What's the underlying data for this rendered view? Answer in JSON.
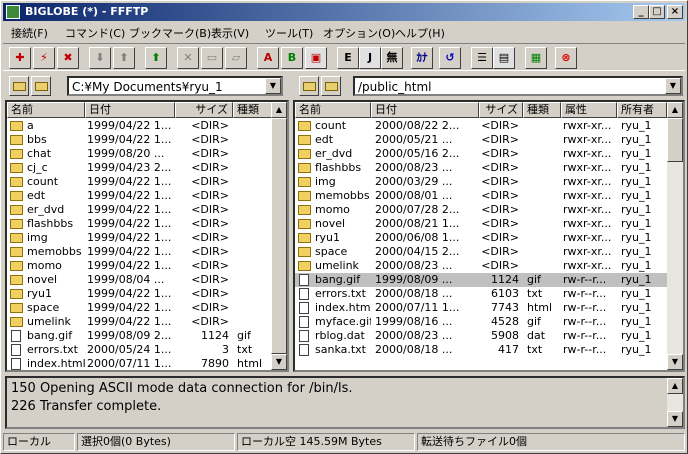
{
  "window": {
    "title": "BIGLOBE (*) - FFFTP",
    "minimize": "_",
    "maximize": "□",
    "close": "×"
  },
  "menu": [
    "接続(F)",
    "コマンド(C)",
    "ブックマーク(B)",
    "表示(V)",
    "ツール(T)",
    "オプション(O)",
    "ヘルプ(H)"
  ],
  "toolbar": {
    "buttons": [
      "connect",
      "quick-connect",
      "disconnect",
      "download",
      "upload",
      "mirror-upload",
      "delete",
      "rename",
      "mkdir",
      "ascii",
      "binary",
      "auto",
      "euc",
      "jis",
      "nokanji",
      "kana",
      "refresh",
      "list",
      "detail",
      "sync",
      "stop"
    ],
    "labels": {
      "ascii": "A",
      "binary": "B",
      "euc": "E",
      "jis": "J",
      "nokanji": "無",
      "kana": "ｶﾅ"
    }
  },
  "left": {
    "path": "C:¥My Documents¥ryu_1",
    "columns": [
      "名前",
      "日付",
      "サイズ",
      "種類"
    ],
    "rows": [
      {
        "name": "a",
        "date": "1999/04/22 1...",
        "size": "<DIR>",
        "type": "",
        "icon": "folder"
      },
      {
        "name": "bbs",
        "date": "1999/04/22 1...",
        "size": "<DIR>",
        "type": "",
        "icon": "folder"
      },
      {
        "name": "chat",
        "date": "1999/08/20 ...",
        "size": "<DIR>",
        "type": "",
        "icon": "folder"
      },
      {
        "name": "cj_c",
        "date": "1999/04/23 2...",
        "size": "<DIR>",
        "type": "",
        "icon": "folder"
      },
      {
        "name": "count",
        "date": "1999/04/22 1...",
        "size": "<DIR>",
        "type": "",
        "icon": "folder"
      },
      {
        "name": "edt",
        "date": "1999/04/22 1...",
        "size": "<DIR>",
        "type": "",
        "icon": "folder"
      },
      {
        "name": "er_dvd",
        "date": "1999/04/22 1...",
        "size": "<DIR>",
        "type": "",
        "icon": "folder"
      },
      {
        "name": "flashbbs",
        "date": "1999/04/22 1...",
        "size": "<DIR>",
        "type": "",
        "icon": "folder"
      },
      {
        "name": "img",
        "date": "1999/04/22 1...",
        "size": "<DIR>",
        "type": "",
        "icon": "folder"
      },
      {
        "name": "memobbs",
        "date": "1999/04/22 1...",
        "size": "<DIR>",
        "type": "",
        "icon": "folder"
      },
      {
        "name": "momo",
        "date": "1999/04/22 1...",
        "size": "<DIR>",
        "type": "",
        "icon": "folder"
      },
      {
        "name": "novel",
        "date": "1999/08/04 ...",
        "size": "<DIR>",
        "type": "",
        "icon": "folder"
      },
      {
        "name": "ryu1",
        "date": "1999/04/22 1...",
        "size": "<DIR>",
        "type": "",
        "icon": "folder"
      },
      {
        "name": "space",
        "date": "1999/04/22 1...",
        "size": "<DIR>",
        "type": "",
        "icon": "folder"
      },
      {
        "name": "umelink",
        "date": "1999/04/22 1...",
        "size": "<DIR>",
        "type": "",
        "icon": "folder"
      },
      {
        "name": "bang.gif",
        "date": "1999/08/09 2...",
        "size": "1124",
        "type": "gif",
        "icon": "file"
      },
      {
        "name": "errors.txt",
        "date": "2000/05/24 1...",
        "size": "3",
        "type": "txt",
        "icon": "file"
      },
      {
        "name": "index.html",
        "date": "2000/07/11 1...",
        "size": "7890",
        "type": "html",
        "icon": "file"
      }
    ]
  },
  "right": {
    "path": "/public_html",
    "columns": [
      "名前",
      "日付",
      "サイズ",
      "種類",
      "属性",
      "所有者"
    ],
    "rows": [
      {
        "name": "count",
        "date": "2000/08/22 2...",
        "size": "<DIR>",
        "type": "",
        "attr": "rwxr-xr...",
        "owner": "ryu_1",
        "icon": "folder"
      },
      {
        "name": "edt",
        "date": "2000/05/21 ...",
        "size": "<DIR>",
        "type": "",
        "attr": "rwxr-xr...",
        "owner": "ryu_1",
        "icon": "folder"
      },
      {
        "name": "er_dvd",
        "date": "2000/05/16 2...",
        "size": "<DIR>",
        "type": "",
        "attr": "rwxr-xr...",
        "owner": "ryu_1",
        "icon": "folder"
      },
      {
        "name": "flashbbs",
        "date": "2000/08/23 ...",
        "size": "<DIR>",
        "type": "",
        "attr": "rwxr-xr...",
        "owner": "ryu_1",
        "icon": "folder"
      },
      {
        "name": "img",
        "date": "2000/03/29 ...",
        "size": "<DIR>",
        "type": "",
        "attr": "rwxr-xr...",
        "owner": "ryu_1",
        "icon": "folder"
      },
      {
        "name": "memobbs",
        "date": "2000/08/01 ...",
        "size": "<DIR>",
        "type": "",
        "attr": "rwxr-xr...",
        "owner": "ryu_1",
        "icon": "folder"
      },
      {
        "name": "momo",
        "date": "2000/07/28 2...",
        "size": "<DIR>",
        "type": "",
        "attr": "rwxr-xr...",
        "owner": "ryu_1",
        "icon": "folder"
      },
      {
        "name": "novel",
        "date": "2000/08/21 1...",
        "size": "<DIR>",
        "type": "",
        "attr": "rwxr-xr...",
        "owner": "ryu_1",
        "icon": "folder"
      },
      {
        "name": "ryu1",
        "date": "2000/06/08 1...",
        "size": "<DIR>",
        "type": "",
        "attr": "rwxr-xr...",
        "owner": "ryu_1",
        "icon": "folder"
      },
      {
        "name": "space",
        "date": "2000/04/15 2...",
        "size": "<DIR>",
        "type": "",
        "attr": "rwxr-xr...",
        "owner": "ryu_1",
        "icon": "folder"
      },
      {
        "name": "umelink",
        "date": "2000/08/23 ...",
        "size": "<DIR>",
        "type": "",
        "attr": "rwxr-xr...",
        "owner": "ryu_1",
        "icon": "folder"
      },
      {
        "name": "bang.gif",
        "date": "1999/08/09 ...",
        "size": "1124",
        "type": "gif",
        "attr": "rw-r--r...",
        "owner": "ryu_1",
        "icon": "file"
      },
      {
        "name": "errors.txt",
        "date": "2000/08/18 ...",
        "size": "6103",
        "type": "txt",
        "attr": "rw-r--r...",
        "owner": "ryu_1",
        "icon": "file"
      },
      {
        "name": "index.html",
        "date": "2000/07/11 1...",
        "size": "7743",
        "type": "html",
        "attr": "rw-r--r...",
        "owner": "ryu_1",
        "icon": "file"
      },
      {
        "name": "myface.gif",
        "date": "1999/08/16 ...",
        "size": "4528",
        "type": "gif",
        "attr": "rw-r--r...",
        "owner": "ryu_1",
        "icon": "file"
      },
      {
        "name": "rblog.dat",
        "date": "2000/08/23 ...",
        "size": "5908",
        "type": "dat",
        "attr": "rw-r--r...",
        "owner": "ryu_1",
        "icon": "file"
      },
      {
        "name": "sanka.txt",
        "date": "2000/08/18 ...",
        "size": "417",
        "type": "txt",
        "attr": "rw-r--r...",
        "owner": "ryu_1",
        "icon": "file"
      }
    ],
    "selected_index": 11
  },
  "log": [
    "150 Opening ASCII mode data connection for /bin/ls.",
    "226 Transfer complete."
  ],
  "status": {
    "local": "ローカル",
    "selection": "選択0個(0 Bytes)",
    "free": "ローカル空 145.59M Bytes",
    "queue": "転送待ちファイル0個"
  }
}
